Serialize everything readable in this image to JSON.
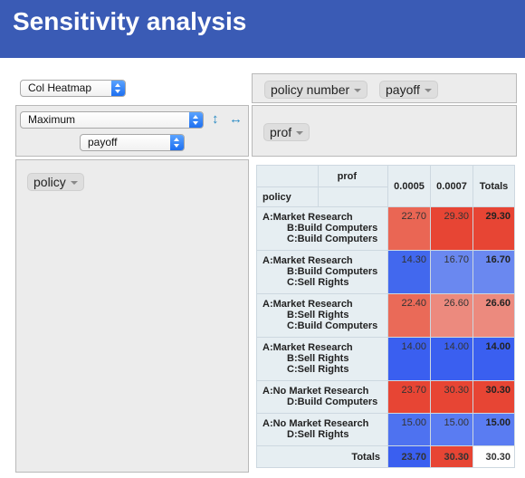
{
  "title": "Sensitivity analysis",
  "controls": {
    "renderer": "Col Heatmap",
    "aggregator": "Maximum",
    "attribute": "payoff"
  },
  "col_area": {
    "pills": [
      "policy number",
      "payoff"
    ]
  },
  "col_header_area": {
    "pills": [
      "prof"
    ]
  },
  "row_area": {
    "pills": [
      "policy"
    ]
  },
  "icons": {
    "sort_rows": "↕",
    "sort_cols": "↔"
  },
  "table": {
    "col_attr": "prof",
    "row_attr": "policy",
    "columns": [
      "0.0005",
      "0.0007",
      "Totals"
    ],
    "rows": [
      {
        "lines": [
          "A:Market Research",
          "B:Build Computers",
          "C:Build Computers"
        ],
        "values": [
          "22.70",
          "29.30",
          "29.30"
        ],
        "colors": [
          "#ea6654",
          "#e74534",
          "#e74534"
        ]
      },
      {
        "lines": [
          "A:Market Research",
          "B:Build Computers",
          "C:Sell Rights"
        ],
        "values": [
          "14.30",
          "16.70",
          "16.70"
        ],
        "colors": [
          "#4268ee",
          "#6a88f0",
          "#6a88f0"
        ]
      },
      {
        "lines": [
          "A:Market Research",
          "B:Sell Rights",
          "C:Build Computers"
        ],
        "values": [
          "22.40",
          "26.60",
          "26.60"
        ],
        "colors": [
          "#ea6a58",
          "#ec8a7e",
          "#ec8a7e"
        ]
      },
      {
        "lines": [
          "A:Market Research",
          "B:Sell Rights",
          "C:Sell Rights"
        ],
        "values": [
          "14.00",
          "14.00",
          "14.00"
        ],
        "colors": [
          "#3a5ff0",
          "#3a5ff0",
          "#3a5ff0"
        ]
      },
      {
        "lines": [
          "A:No Market Research",
          "D:Build Computers"
        ],
        "values": [
          "23.70",
          "30.30",
          "30.30"
        ],
        "colors": [
          "#e74534",
          "#e74534",
          "#e74534"
        ]
      },
      {
        "lines": [
          "A:No Market Research",
          "D:Sell Rights"
        ],
        "values": [
          "15.00",
          "15.00",
          "15.00"
        ],
        "colors": [
          "#4e72f0",
          "#5a7cf2",
          "#5a7cf2"
        ]
      }
    ],
    "totals_label": "Totals",
    "totals": [
      "23.70",
      "30.30",
      "30.30"
    ],
    "totals_colors": [
      "#3a5ff0",
      "#e74534",
      "#ffffff"
    ]
  }
}
